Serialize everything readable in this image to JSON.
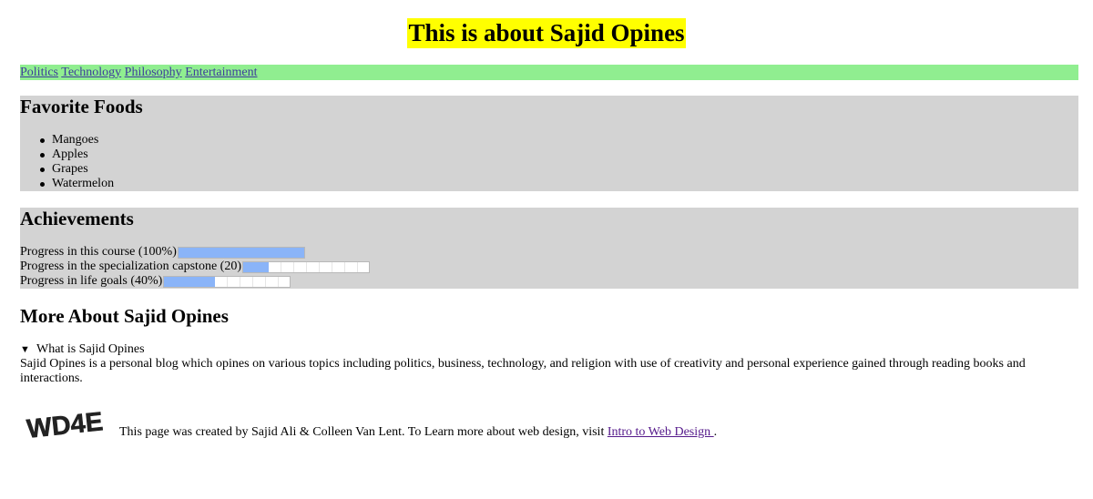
{
  "header": {
    "title": "This is about Sajid Opines"
  },
  "nav": {
    "links": [
      "Politics",
      "Technology",
      "Philosophy",
      "Entertainment"
    ]
  },
  "foods": {
    "heading": "Favorite Foods",
    "items": [
      "Mangoes",
      "Apples",
      "Grapes",
      "Watermelon"
    ]
  },
  "achievements": {
    "heading": "Achievements",
    "progress": [
      {
        "label": "Progress in this course (100%)",
        "value": 100,
        "max": 100
      },
      {
        "label": "Progress in the specialization capstone (20)",
        "value": 20,
        "max": 100
      },
      {
        "label": "Progress in life goals (40%)",
        "value": 40,
        "max": 100
      }
    ]
  },
  "more": {
    "heading": "More About Sajid Opines",
    "summary": "What is Sajid Opines",
    "body": "Sajid Opines is a personal blog which opines on various topics including politics, business, technology, and religion with use of creativity and personal experience gained through reading books and interactions."
  },
  "footer": {
    "logo_text": "WD4E",
    "text": "This page was created by Sajid Ali & Colleen Van Lent. To Learn more about web design, visit ",
    "link_text": "Intro to Web Design ",
    "after_link": "."
  },
  "colors": {
    "title_bg": "#ffff00",
    "nav_bg": "#90ee90",
    "section_bg": "#d3d3d3",
    "progress_fill": "#8ab4f8"
  }
}
